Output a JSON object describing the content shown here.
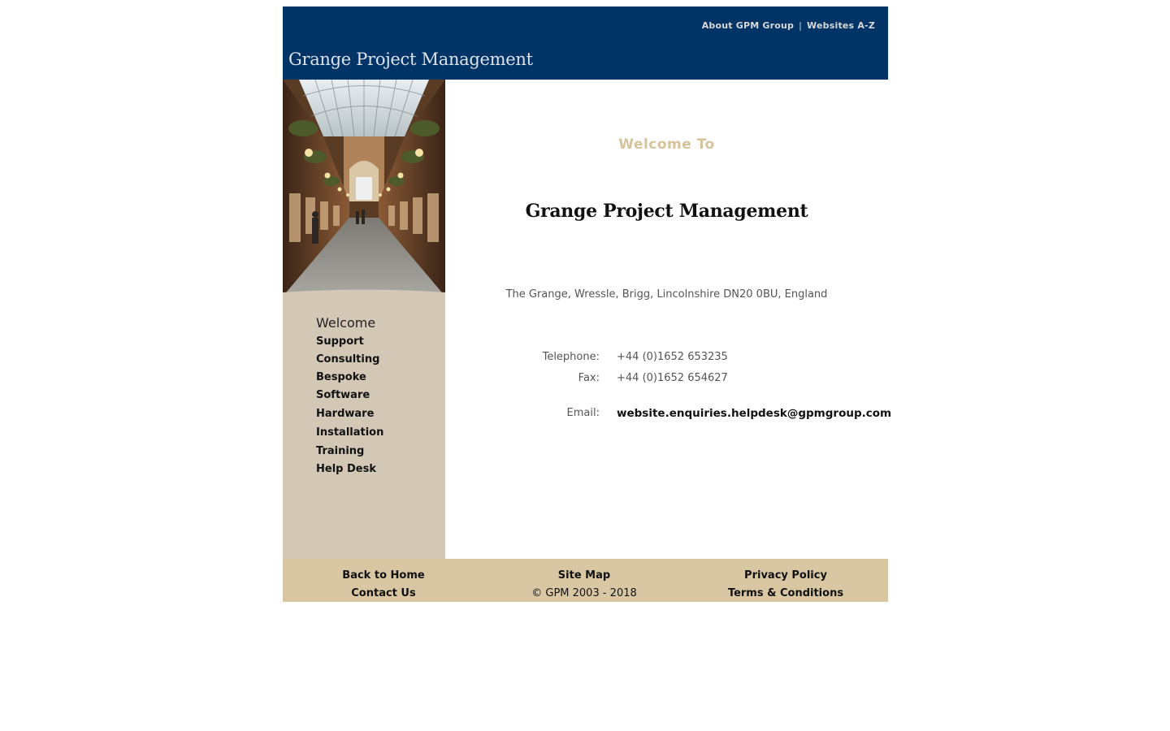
{
  "header": {
    "top_links": {
      "about": "About GPM Group",
      "separator": "|",
      "websites": "Websites A-Z"
    },
    "site_title": "Grange Project Management",
    "background_color": "#003366"
  },
  "sidebar": {
    "image_icon": "shopping-arcade-photo",
    "nav": [
      {
        "label": "Welcome"
      },
      {
        "label": "Support"
      },
      {
        "label": "Consulting"
      },
      {
        "label": "Bespoke"
      },
      {
        "label": "Software"
      },
      {
        "label": "Hardware"
      },
      {
        "label": "Installation"
      },
      {
        "label": "Training"
      },
      {
        "label": "Help Desk"
      }
    ],
    "background_color": "#d3c8b6"
  },
  "main": {
    "welcome_to": "Welcome To",
    "company_name": "Grange Project Management",
    "address": "The Grange, Wressle, Brigg, Lincolnshire DN20 0BU, England",
    "contact": {
      "telephone_label": "Telephone:",
      "telephone_value": "+44 (0)1652 653235",
      "fax_label": "Fax:",
      "fax_value": "+44 (0)1652 654627",
      "email_label": "Email:",
      "email_value": "website.enquiries.helpdesk@gpmgroup.com"
    },
    "accent_color": "#d6c39b"
  },
  "footer": {
    "back_to_home": "Back to Home",
    "contact_us": "Contact Us",
    "site_map": "Site Map",
    "copyright": "© GPM 2003 - 2018",
    "privacy_policy": "Privacy Policy",
    "terms": "Terms & Conditions",
    "background_color": "#d9c7a3"
  }
}
